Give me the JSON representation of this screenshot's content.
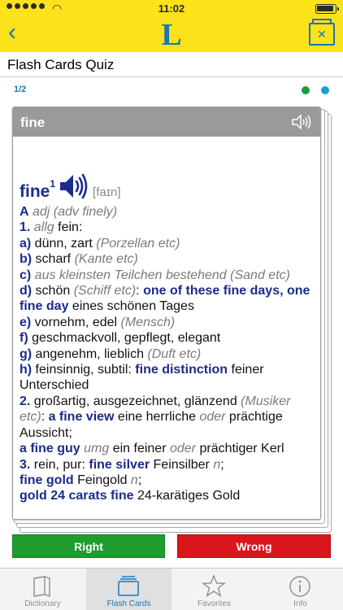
{
  "status": {
    "time": "11:02"
  },
  "nav": {
    "logo_letter": "L"
  },
  "title": "Flash Cards Quiz",
  "progress": "1/2",
  "card": {
    "header_word": "fine",
    "headword": "fine",
    "superscript": "1",
    "phonetic": "[faɪn]",
    "lines": [
      [
        {
          "t": "A",
          "c": "b"
        },
        {
          "t": " adj (adv finely)",
          "c": "i"
        }
      ],
      [
        {
          "t": "1.",
          "c": "b"
        },
        {
          "t": " "
        },
        {
          "t": "allg",
          "c": "i"
        },
        {
          "t": " fein:"
        }
      ],
      [
        {
          "t": "a)",
          "c": "b"
        },
        {
          "t": " dünn, zart "
        },
        {
          "t": "(Porzellan etc)",
          "c": "i"
        }
      ],
      [
        {
          "t": "b)",
          "c": "b"
        },
        {
          "t": " scharf "
        },
        {
          "t": "(Kante etc)",
          "c": "i"
        }
      ],
      [
        {
          "t": "c)",
          "c": "b"
        },
        {
          "t": " aus kleinsten Teilchen bestehend (Sand etc)",
          "c": "i"
        }
      ],
      [
        {
          "t": "d)",
          "c": "b"
        },
        {
          "t": " schön "
        },
        {
          "t": "(Schiff etc)",
          "c": "i"
        },
        {
          "t": ": "
        },
        {
          "t": "one of these fine days, one fine day",
          "c": "b"
        },
        {
          "t": " eines schönen Tages"
        }
      ],
      [
        {
          "t": "e)",
          "c": "b"
        },
        {
          "t": " vornehm, edel "
        },
        {
          "t": "(Mensch)",
          "c": "i"
        }
      ],
      [
        {
          "t": "f)",
          "c": "b"
        },
        {
          "t": " geschmackvoll, gepflegt, elegant"
        }
      ],
      [
        {
          "t": "g)",
          "c": "b"
        },
        {
          "t": " angenehm, lieblich "
        },
        {
          "t": "(Duft etc)",
          "c": "i"
        }
      ],
      [
        {
          "t": "h)",
          "c": "b"
        },
        {
          "t": " feinsinnig, subtil: "
        },
        {
          "t": "fine distinction",
          "c": "b"
        },
        {
          "t": " feiner Unterschied"
        }
      ],
      [
        {
          "t": "2.",
          "c": "b"
        },
        {
          "t": " großartig, ausgezeichnet, glänzend "
        },
        {
          "t": "(Musiker etc)",
          "c": "i"
        },
        {
          "t": ": "
        },
        {
          "t": "a fine view",
          "c": "b"
        },
        {
          "t": " eine herrliche "
        },
        {
          "t": "oder",
          "c": "i"
        },
        {
          "t": " prächtige Aussicht;"
        }
      ],
      [
        {
          "t": "a fine guy",
          "c": "b"
        },
        {
          "t": " "
        },
        {
          "t": "umg",
          "c": "i"
        },
        {
          "t": " ein feiner "
        },
        {
          "t": "oder",
          "c": "i"
        },
        {
          "t": " prächtiger Kerl"
        }
      ],
      [
        {
          "t": "3.",
          "c": "b"
        },
        {
          "t": " rein, pur: "
        },
        {
          "t": "fine silver",
          "c": "b"
        },
        {
          "t": " Feinsilber "
        },
        {
          "t": "n",
          "c": "i"
        },
        {
          "t": ";"
        }
      ],
      [
        {
          "t": "fine gold",
          "c": "b"
        },
        {
          "t": " Feingold "
        },
        {
          "t": "n",
          "c": "i"
        },
        {
          "t": ";"
        }
      ],
      [
        {
          "t": "gold 24 carats fine",
          "c": "b"
        },
        {
          "t": " 24-karätiges Gold"
        }
      ]
    ]
  },
  "buttons": {
    "right": "Right",
    "wrong": "Wrong"
  },
  "tabs": [
    {
      "label": "Dictionary",
      "icon": "book-icon"
    },
    {
      "label": "Flash Cards",
      "icon": "flashcards-icon"
    },
    {
      "label": "Favorites",
      "icon": "star-icon"
    },
    {
      "label": "Info",
      "icon": "info-icon"
    }
  ],
  "active_tab": "Flash Cards",
  "colors": {
    "brand_yellow": "#FCE21B",
    "brand_blue": "#1a76b9",
    "right": "#1e9c2f",
    "wrong": "#d8161c",
    "headword": "#1b2c8a"
  },
  "battery_level": 0.95
}
